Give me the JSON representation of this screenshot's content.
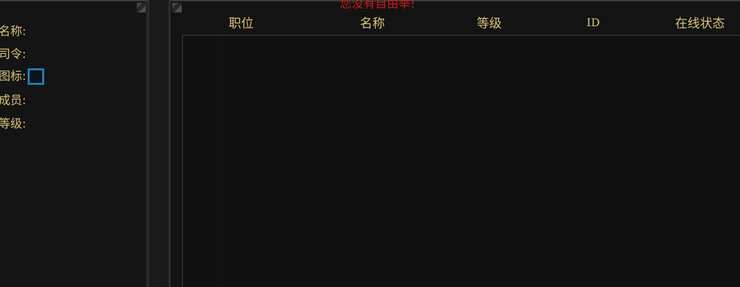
{
  "notice": "您没有自由举!",
  "guild_info": {
    "name_label": "名称:",
    "commander_label": "司令:",
    "icon_label": "图标:",
    "members_label": "成员:",
    "level_label": "等级:"
  },
  "member_table": {
    "columns": [
      "职位",
      "名称",
      "等级",
      "ID",
      "在线状态"
    ],
    "rows": []
  },
  "colors": {
    "label_text": "#d9c27a",
    "notice_text": "#d01818",
    "icon_slot_border": "#1d7fb8",
    "panel_bg": "#131313"
  }
}
